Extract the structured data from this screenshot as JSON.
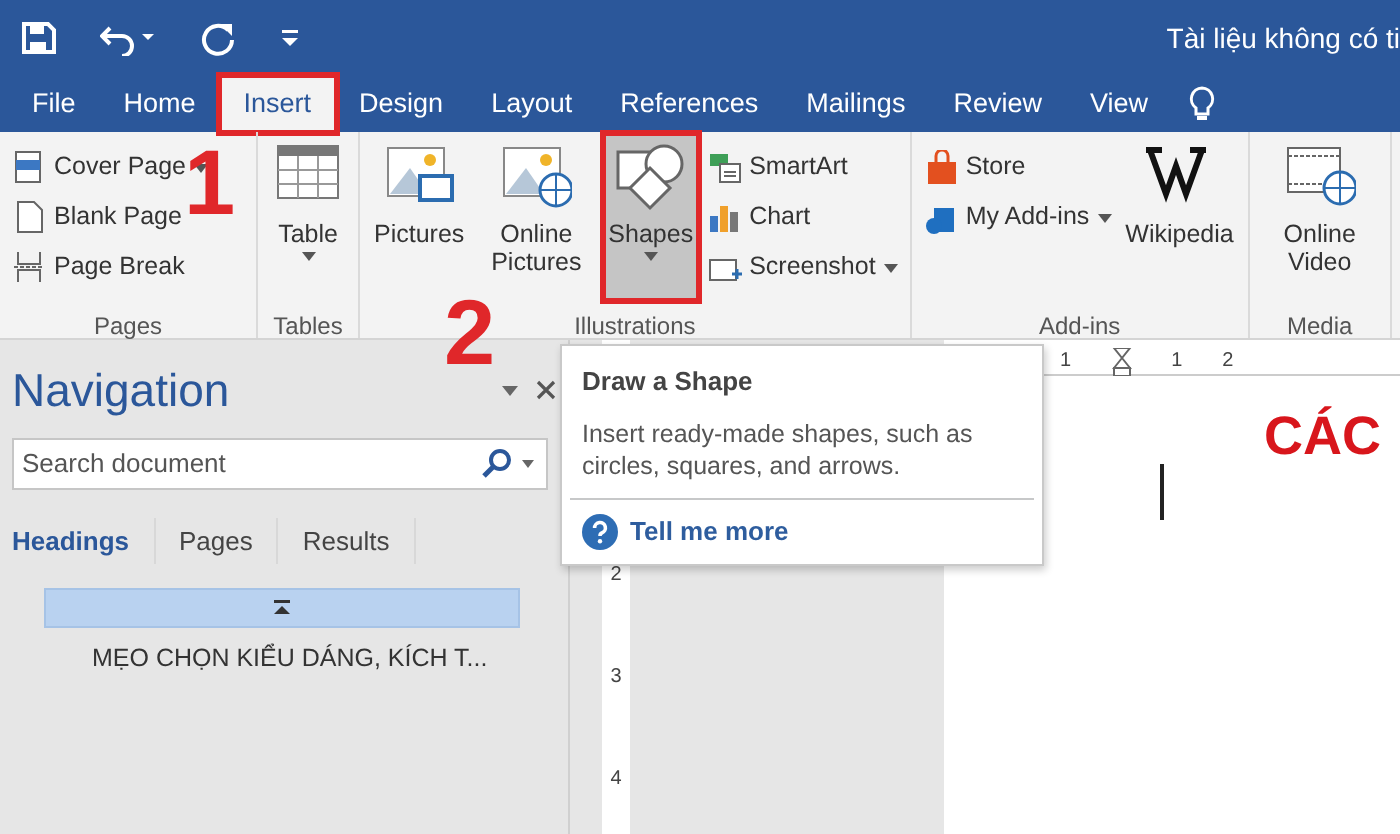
{
  "title_bar": {
    "title": "Tài liệu không có ti"
  },
  "tabs": [
    {
      "label": "File",
      "selected": false,
      "marked": false
    },
    {
      "label": "Home",
      "selected": false,
      "marked": false
    },
    {
      "label": "Insert",
      "selected": true,
      "marked": true
    },
    {
      "label": "Design",
      "selected": false,
      "marked": false
    },
    {
      "label": "Layout",
      "selected": false,
      "marked": false
    },
    {
      "label": "References",
      "selected": false,
      "marked": false
    },
    {
      "label": "Mailings",
      "selected": false,
      "marked": false
    },
    {
      "label": "Review",
      "selected": false,
      "marked": false
    },
    {
      "label": "View",
      "selected": false,
      "marked": false
    }
  ],
  "ribbon": {
    "groups": [
      {
        "label": "Pages",
        "items": [
          {
            "kind": "stack",
            "items": [
              {
                "label": "Cover Page",
                "dropdown": true
              },
              {
                "label": "Blank Page",
                "dropdown": false
              },
              {
                "label": "Page Break",
                "dropdown": false
              }
            ]
          }
        ]
      },
      {
        "label": "Tables",
        "items": [
          {
            "kind": "large",
            "label": "Table",
            "dropdown": true,
            "selected": false,
            "marked": false
          }
        ]
      },
      {
        "label": "Illustrations",
        "items": [
          {
            "kind": "large",
            "label": "Pictures",
            "dropdown": false,
            "selected": false,
            "marked": false
          },
          {
            "kind": "large",
            "label": "Online Pictures",
            "dropdown": false,
            "selected": false,
            "marked": false
          },
          {
            "kind": "large",
            "label": "Shapes",
            "dropdown": true,
            "selected": true,
            "marked": true
          },
          {
            "kind": "stack",
            "items": [
              {
                "label": "SmartArt",
                "dropdown": false
              },
              {
                "label": "Chart",
                "dropdown": false
              },
              {
                "label": "Screenshot",
                "dropdown": true
              }
            ]
          }
        ]
      },
      {
        "label": "Add-ins",
        "items": [
          {
            "kind": "stack",
            "items": [
              {
                "label": "Store",
                "dropdown": false
              },
              {
                "label": "My Add-ins",
                "dropdown": true
              }
            ]
          },
          {
            "kind": "large",
            "label": "Wikipedia",
            "dropdown": false,
            "selected": false,
            "marked": false
          }
        ]
      },
      {
        "label": "Media",
        "items": [
          {
            "kind": "large",
            "label": "Online Video",
            "dropdown": false,
            "selected": false,
            "marked": false
          }
        ]
      }
    ]
  },
  "annotations": [
    {
      "label": "1"
    },
    {
      "label": "2"
    }
  ],
  "navigation": {
    "title": "Navigation",
    "search": {
      "placeholder": "Search document"
    },
    "tabs": [
      {
        "label": "Headings",
        "selected": true
      },
      {
        "label": "Pages",
        "selected": false
      },
      {
        "label": "Results",
        "selected": false
      }
    ],
    "headings": [
      {
        "text": "MẸO CHỌN KIỂU DÁNG, KÍCH T...",
        "selected": true
      }
    ]
  },
  "tooltip": {
    "title": "Draw a Shape",
    "text": "Insert ready-made shapes, such as circles, squares, and arrows.",
    "link": "Tell me more"
  },
  "rulers": {
    "horizontal": [
      "1",
      "1",
      "2"
    ],
    "vertical": [
      "2",
      "3",
      "4"
    ]
  },
  "document": {
    "heading": "CÁC"
  }
}
